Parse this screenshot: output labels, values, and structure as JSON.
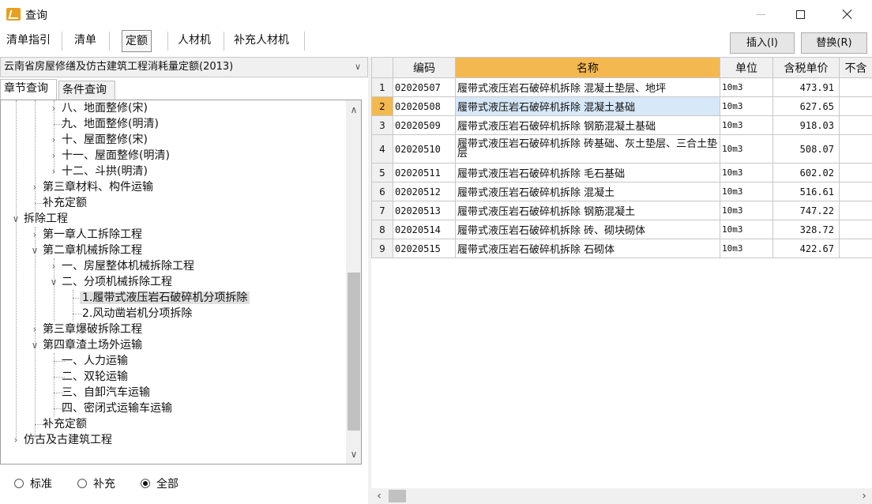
{
  "window": {
    "title": "查询"
  },
  "toolbar": {
    "tabs": [
      "清单指引",
      "清单",
      "定额",
      "人材机",
      "补充人材机"
    ],
    "active_tab": "定额",
    "insert_label": "插入(I)",
    "replace_label": "替换(R)"
  },
  "left": {
    "quota_library": "云南省房屋修缮及仿古建筑工程消耗量定额(2013)",
    "subtabs": [
      "章节查询",
      "条件查询"
    ],
    "tree": [
      "八、地面整修(宋)",
      "九、地面整修(明清)",
      "十、屋面整修(宋)",
      "十一、屋面整修(明清)",
      "十二、斗拱(明清)",
      "第三章材料、构件运输",
      "补充定额",
      "拆除工程",
      "第一章人工拆除工程",
      "第二章机械拆除工程",
      "一、房屋整体机械拆除工程",
      "二、分项机械拆除工程",
      "1.履带式液压岩石破碎机分项拆除",
      "2.风动凿岩机分项拆除",
      "第三章爆破拆除工程",
      "第四章渣土场外运输",
      "一、人力运输",
      "二、双轮运输",
      "三、自卸汽车运输",
      "四、密闭式运输车运输",
      "补充定额",
      "仿古及古建筑工程"
    ],
    "radios": [
      "标准",
      "补充",
      "全部"
    ],
    "radio_selected": "全部"
  },
  "table": {
    "headers": [
      "编码",
      "名称",
      "单位",
      "含税单价",
      "不含"
    ],
    "rows": [
      {
        "idx": "1",
        "code": "02020507",
        "name": "履带式液压岩石破碎机拆除 混凝土垫层、地坪",
        "unit": "10m3",
        "price": "473.91"
      },
      {
        "idx": "2",
        "code": "02020508",
        "name": "履带式液压岩石破碎机拆除 混凝土基础",
        "unit": "10m3",
        "price": "627.65"
      },
      {
        "idx": "3",
        "code": "02020509",
        "name": "履带式液压岩石破碎机拆除 钢筋混凝土基础",
        "unit": "10m3",
        "price": "918.03"
      },
      {
        "idx": "4",
        "code": "02020510",
        "name": "履带式液压岩石破碎机拆除 砖基础、灰土垫层、三合土垫层",
        "unit": "10m3",
        "price": "508.07"
      },
      {
        "idx": "5",
        "code": "02020511",
        "name": "履带式液压岩石破碎机拆除 毛石基础",
        "unit": "10m3",
        "price": "602.02"
      },
      {
        "idx": "6",
        "code": "02020512",
        "name": "履带式液压岩石破碎机拆除 混凝土",
        "unit": "10m3",
        "price": "516.61"
      },
      {
        "idx": "7",
        "code": "02020513",
        "name": "履带式液压岩石破碎机拆除 钢筋混凝土",
        "unit": "10m3",
        "price": "747.22"
      },
      {
        "idx": "8",
        "code": "02020514",
        "name": "履带式液压岩石破碎机拆除 砖、砌块砌体",
        "unit": "10m3",
        "price": "328.72"
      },
      {
        "idx": "9",
        "code": "02020515",
        "name": "履带式液压岩石破碎机拆除 石砌体",
        "unit": "10m3",
        "price": "422.67"
      }
    ]
  },
  "colors": {
    "header_highlight": "#f4b850",
    "selected_row": "#d7e8f8",
    "panel_bg": "#f0f0f0"
  }
}
